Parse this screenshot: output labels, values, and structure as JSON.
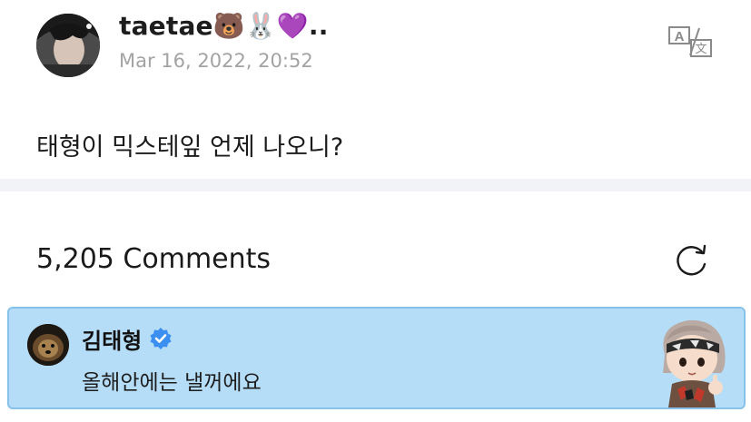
{
  "post": {
    "author_name": "taetae🐻🐰💜..",
    "timestamp": "Mar 16, 2022, 20:52",
    "body": "태형이 믹스테잎 언제 나오니?",
    "translate_icon": "translate-icon"
  },
  "comments": {
    "count_label": "5,205 Comments",
    "refresh_icon": "refresh-icon"
  },
  "artist_comment": {
    "author_name": "김태형",
    "verified_icon": "verified-badge-icon",
    "text": "올해안에는 낼꺼에요",
    "highlight_color": "#b6ddf7",
    "sticker": "character-sticker"
  }
}
